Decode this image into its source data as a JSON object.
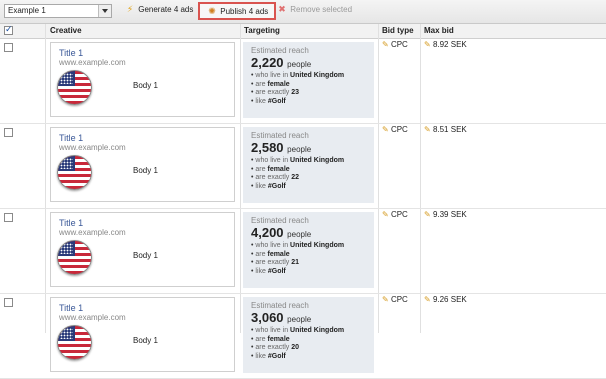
{
  "toolbar": {
    "select_value": "Example 1",
    "generate_label": "Generate 4 ads",
    "publish_label": "Publish 4 ads",
    "remove_label": "Remove selected",
    "generate_icon": "lightning-icon",
    "publish_icon": "publish-icon",
    "remove_icon": "close-icon"
  },
  "table": {
    "columns": [
      "Creative",
      "Targeting",
      "Bid type",
      "Max bid"
    ]
  },
  "rows": [
    {
      "title": "Title 1",
      "url": "www.example.com",
      "body": "Body 1",
      "reach_label": "Estimated reach",
      "reach": "2,220",
      "unit": "people",
      "t1_pre": "who live in",
      "t1_val": "United Kingdom",
      "t2_pre": "are",
      "t2_val": "female",
      "t3_pre": "are exactly",
      "t3_val": "23",
      "t4_pre": "like",
      "t4_val": "#Golf",
      "bid_type": "CPC",
      "max_bid": "8.92 SEK"
    },
    {
      "title": "Title 1",
      "url": "www.example.com",
      "body": "Body 1",
      "reach_label": "Estimated reach",
      "reach": "2,580",
      "unit": "people",
      "t1_pre": "who live in",
      "t1_val": "United Kingdom",
      "t2_pre": "are",
      "t2_val": "female",
      "t3_pre": "are exactly",
      "t3_val": "22",
      "t4_pre": "like",
      "t4_val": "#Golf",
      "bid_type": "CPC",
      "max_bid": "8.51 SEK"
    },
    {
      "title": "Title 1",
      "url": "www.example.com",
      "body": "Body 1",
      "reach_label": "Estimated reach",
      "reach": "4,200",
      "unit": "people",
      "t1_pre": "who live in",
      "t1_val": "United Kingdom",
      "t2_pre": "are",
      "t2_val": "female",
      "t3_pre": "are exactly",
      "t3_val": "21",
      "t4_pre": "like",
      "t4_val": "#Golf",
      "bid_type": "CPC",
      "max_bid": "9.39 SEK"
    },
    {
      "title": "Title 1",
      "url": "www.example.com",
      "body": "Body 1",
      "reach_label": "Estimated reach",
      "reach": "3,060",
      "unit": "people",
      "t1_pre": "who live in",
      "t1_val": "United Kingdom",
      "t2_pre": "are",
      "t2_val": "female",
      "t3_pre": "are exactly",
      "t3_val": "20",
      "t4_pre": "like",
      "t4_val": "#Golf",
      "bid_type": "CPC",
      "max_bid": "9.26 SEK"
    }
  ]
}
